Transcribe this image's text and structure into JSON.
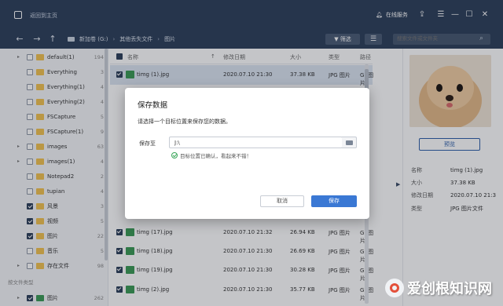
{
  "titlebar": {
    "title": "返回到主页",
    "service_label": "在线服务",
    "share_glyph": "⇪",
    "menu_glyph": "☰",
    "min_glyph": "—",
    "max_glyph": "☐",
    "close_glyph": "✕"
  },
  "nav": {
    "back_glyph": "←",
    "forward_glyph": "→",
    "up_glyph": "↑",
    "breadcrumbs": [
      "新加卷 (G:)",
      "其他丢失文件",
      "图片"
    ],
    "filter_label": "筛选",
    "list_glyph": "☰",
    "search_placeholder": "搜索文件或文件夹"
  },
  "sidebar": {
    "items": [
      {
        "name": "default(1)",
        "count": "194",
        "checked": false,
        "expand": "▸"
      },
      {
        "name": "Everything",
        "count": "3",
        "checked": false,
        "expand": ""
      },
      {
        "name": "Everything(1)",
        "count": "4",
        "checked": false,
        "expand": ""
      },
      {
        "name": "Everything(2)",
        "count": "4",
        "checked": false,
        "expand": ""
      },
      {
        "name": "FSCapture",
        "count": "5",
        "checked": false,
        "expand": ""
      },
      {
        "name": "FSCapture(1)",
        "count": "9",
        "checked": false,
        "expand": ""
      },
      {
        "name": "images",
        "count": "63",
        "checked": false,
        "expand": "▸"
      },
      {
        "name": "images(1)",
        "count": "4",
        "checked": false,
        "expand": "▸"
      },
      {
        "name": "Notepad2",
        "count": "2",
        "checked": false,
        "expand": ""
      },
      {
        "name": "tupian",
        "count": "4",
        "checked": false,
        "expand": ""
      },
      {
        "name": "风景",
        "count": "3",
        "checked": true,
        "expand": ""
      },
      {
        "name": "视频",
        "count": "5",
        "checked": true,
        "expand": ""
      },
      {
        "name": "图片",
        "count": "22",
        "checked": true,
        "expand": ""
      },
      {
        "name": "音乐",
        "count": "5",
        "checked": false,
        "expand": ""
      },
      {
        "name": "存在文件",
        "count": "98",
        "checked": false,
        "expand": "▸"
      }
    ],
    "section_label": "按文件类型",
    "type_item": {
      "name": "图片",
      "count": "262"
    }
  },
  "filelist": {
    "headers": {
      "name": "名称",
      "date": "修改日期",
      "size": "大小",
      "type": "类型",
      "path": "路径"
    },
    "sort_glyph": "↑",
    "rows": [
      {
        "name": "timg (1).jpg",
        "date": "2020.07.10 21:30",
        "size": "37.38 KB",
        "type": "JPG 图片",
        "path": "G:\\图片"
      },
      {
        "name": "timg (17).jpg",
        "date": "2020.07.10 21:32",
        "size": "26.94 KB",
        "type": "JPG 图片",
        "path": "G:\\图片"
      },
      {
        "name": "timg (18).jpg",
        "date": "2020.07.10 21:30",
        "size": "26.69 KB",
        "type": "JPG 图片",
        "path": "G:\\图片"
      },
      {
        "name": "timg (19).jpg",
        "date": "2020.07.10 21:30",
        "size": "30.28 KB",
        "type": "JPG 图片",
        "path": "G:\\图片"
      },
      {
        "name": "timg (2).jpg",
        "date": "2020.07.10 21:30",
        "size": "35.77 KB",
        "type": "JPG 图片",
        "path": "G:\\图片"
      }
    ],
    "expand_glyph": "▶"
  },
  "preview": {
    "button_label": "预览",
    "meta": [
      {
        "key": "名称",
        "value": "timg (1).jpg"
      },
      {
        "key": "大小",
        "value": "37.38 KB"
      },
      {
        "key": "修改日期",
        "value": "2020.07.10 21:3"
      },
      {
        "key": "类型",
        "value": "JPG 图片文件"
      }
    ]
  },
  "dialog": {
    "title": "保存数据",
    "description": "请选择一个目标位置来保存您的数据。",
    "location_label": "保存至",
    "location_value": "J:\\",
    "status_text": "目标位置已确认，看起来不错！",
    "cancel_label": "取消",
    "save_label": "保存"
  },
  "watermark": {
    "text": "爱创根知识网"
  },
  "colors": {
    "titlebar": "#2d3f5a",
    "accent": "#3a78d4",
    "folder": "#f2c24f"
  }
}
